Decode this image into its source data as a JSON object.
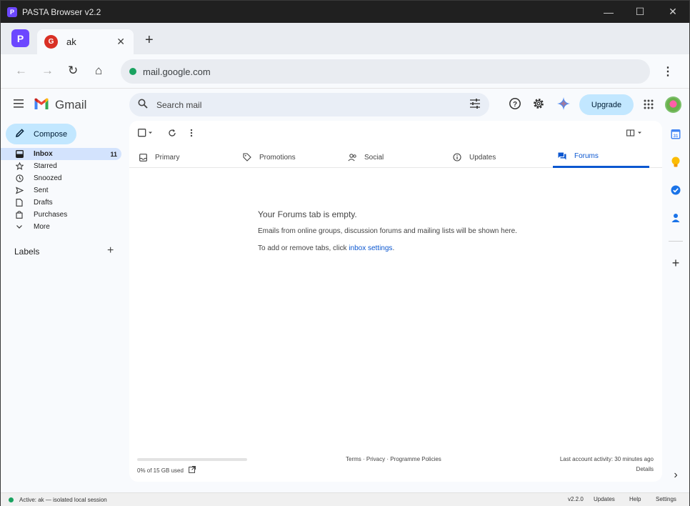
{
  "window": {
    "title": "PASTA Browser v2.2",
    "logo_letter": "P",
    "minimize": "—",
    "maximize": "☐",
    "close": "✕"
  },
  "tabstrip": {
    "profile_letter": "P",
    "tab_favicon_letter": "G",
    "tab_title": "ak",
    "tab_close": "✕",
    "new_tab": "+"
  },
  "toolbar": {
    "back": "←",
    "forward": "→",
    "reload": "↻",
    "home": "⌂",
    "url": "mail.google.com",
    "menu": "⋮"
  },
  "gmail": {
    "app_name": "Gmail",
    "search_placeholder": "Search mail",
    "upgrade_label": "Upgrade",
    "compose_label": "Compose",
    "nav": [
      {
        "label": "Inbox",
        "count": "11",
        "icon": "inbox-icon"
      },
      {
        "label": "Starred",
        "count": "",
        "icon": "star-icon"
      },
      {
        "label": "Snoozed",
        "count": "",
        "icon": "clock-icon"
      },
      {
        "label": "Sent",
        "count": "",
        "icon": "send-icon"
      },
      {
        "label": "Drafts",
        "count": "",
        "icon": "draft-icon"
      },
      {
        "label": "Purchases",
        "count": "",
        "icon": "purchases-icon"
      },
      {
        "label": "More",
        "count": "",
        "icon": "chevron-down-icon"
      }
    ],
    "labels_heading": "Labels",
    "labels_add": "+",
    "category_tabs": [
      {
        "label": "Primary",
        "icon": "inbox-icon"
      },
      {
        "label": "Promotions",
        "icon": "tag-icon"
      },
      {
        "label": "Social",
        "icon": "people-icon"
      },
      {
        "label": "Updates",
        "icon": "info-icon"
      },
      {
        "label": "Forums",
        "icon": "forum-icon",
        "selected": true
      }
    ],
    "empty_state": {
      "title": "Your Forums tab is empty.",
      "description": "Emails from online groups, discussion forums and mailing lists will be shown here.",
      "link_prefix": "To add or remove tabs, click ",
      "link_text": "inbox settings",
      "link_suffix": "."
    },
    "footer": {
      "storage_used_fraction": 0,
      "storage_text": "0% of 15 GB used",
      "links": "Terms · Privacy · Programme Policies",
      "activity": "Last account activity: 30 minutes ago",
      "details": "Details"
    },
    "side_panel_calendar_day": "31",
    "side_panel_expand": "›"
  },
  "statusbar": {
    "session": "Active: ak — isolated local session",
    "version": "v2.2.0",
    "updates": "Updates",
    "help": "Help",
    "settings": "Settings"
  },
  "colors": {
    "accent": "#0b57d0",
    "compose_bg": "#c2e7ff",
    "active_nav": "#d3e3fd",
    "brand": "#6c47ff"
  }
}
